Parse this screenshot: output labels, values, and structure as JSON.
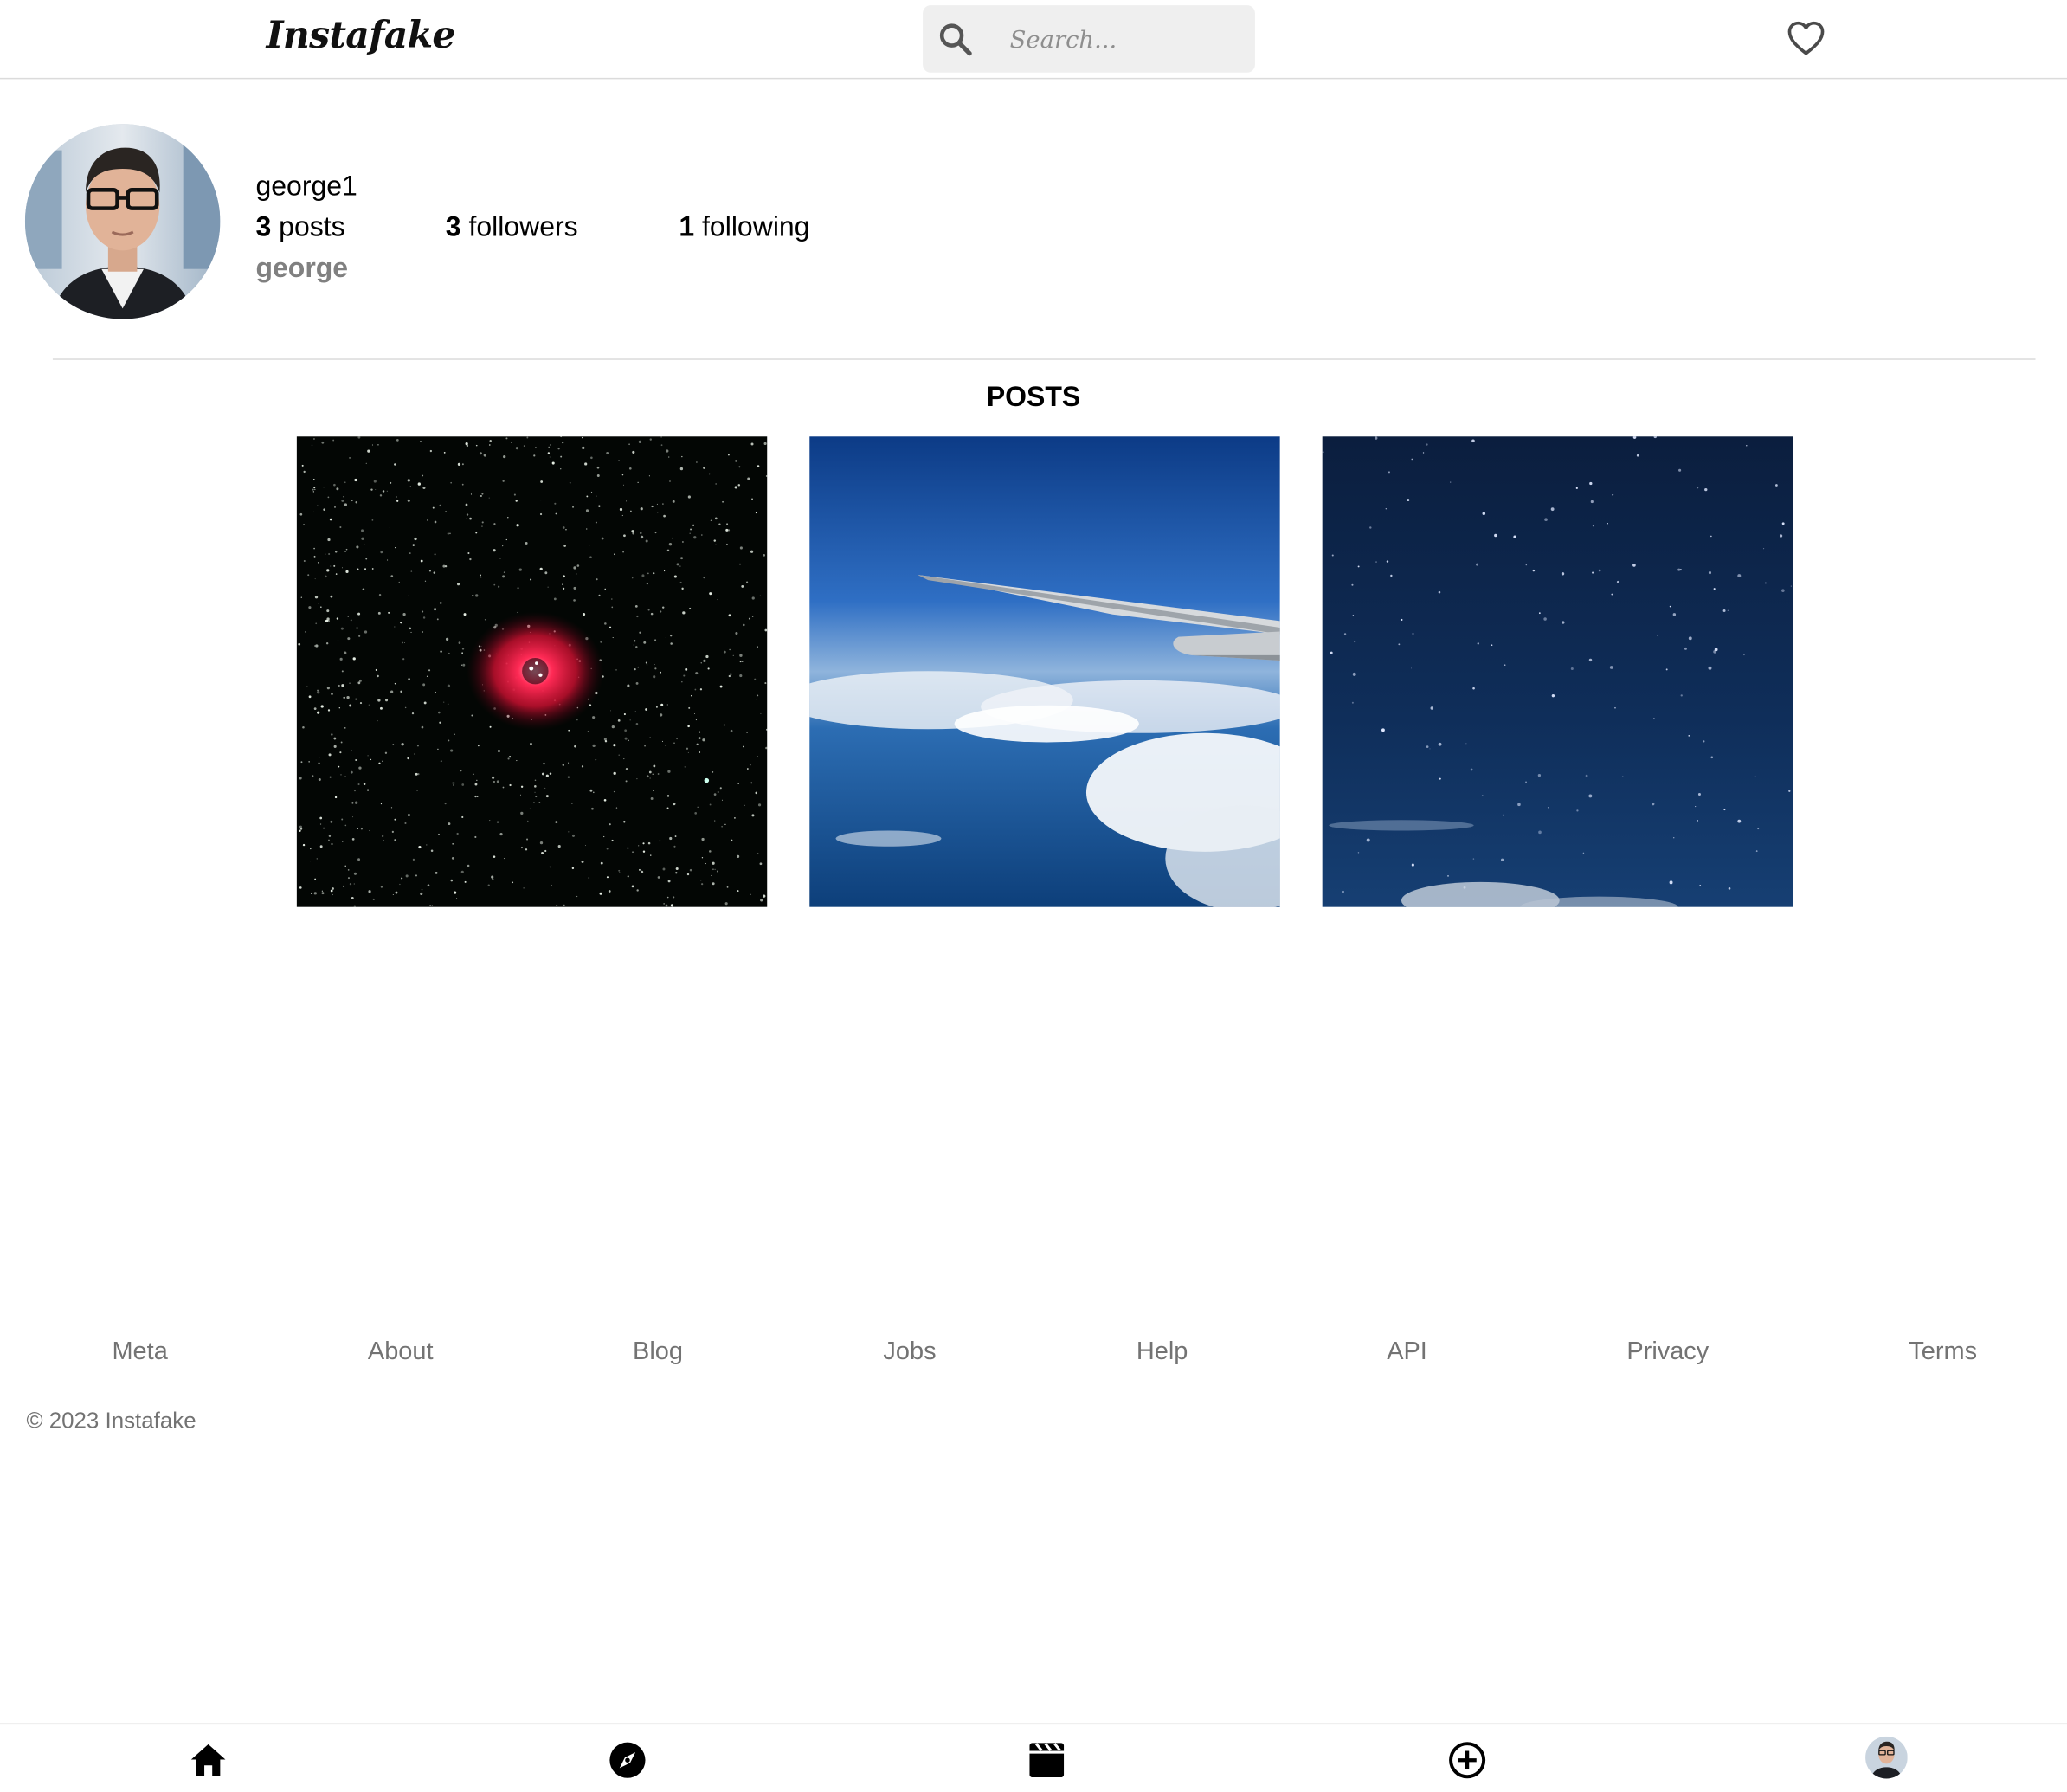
{
  "header": {
    "logo": "Instafake",
    "search_placeholder": "Search...",
    "search_icon": "search-icon",
    "notifications_icon": "heart-icon"
  },
  "profile": {
    "username": "george1",
    "posts_count": "3",
    "posts_label": "posts",
    "followers_count": "3",
    "followers_label": "followers",
    "following_count": "1",
    "following_label": "following",
    "full_name": "george"
  },
  "posts_section": {
    "title": "POSTS",
    "posts": [
      {
        "subject": "red nebula in starfield"
      },
      {
        "subject": "airplane wing above clouds"
      },
      {
        "subject": "starry night sky"
      }
    ]
  },
  "footer": {
    "links": [
      "Meta",
      "About",
      "Blog",
      "Jobs",
      "Help",
      "API",
      "Privacy",
      "Terms"
    ],
    "copyright": "© 2023 Instafake"
  },
  "bottom_nav": {
    "items": [
      "home-icon",
      "explore-icon",
      "reels-icon",
      "create-icon",
      "profile-avatar"
    ]
  }
}
